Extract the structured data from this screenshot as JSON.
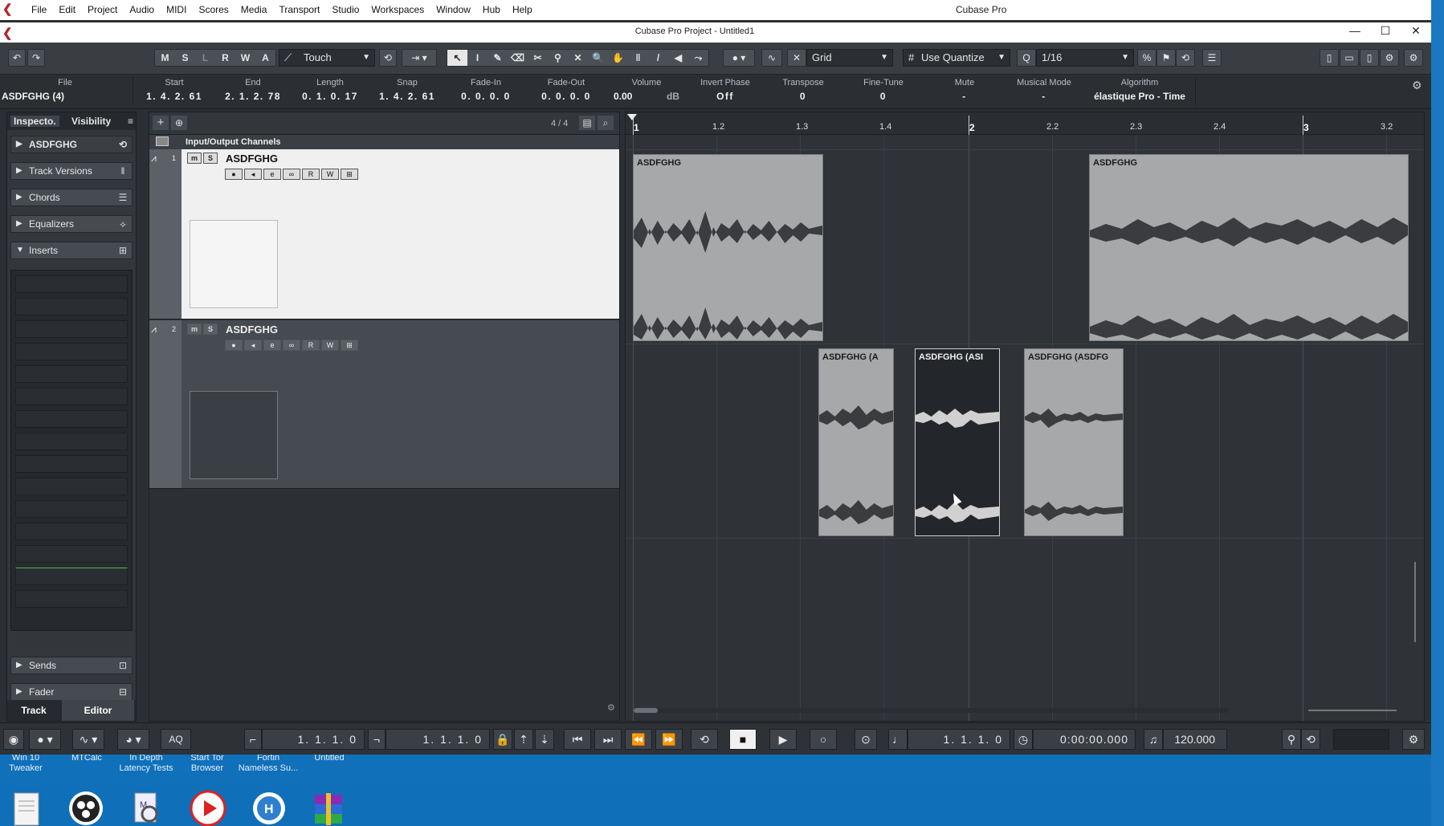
{
  "menubar": {
    "items": [
      "File",
      "Edit",
      "Project",
      "Audio",
      "MIDI",
      "Scores",
      "Media",
      "Transport",
      "Studio",
      "Workspaces",
      "Window",
      "Hub",
      "Help"
    ],
    "app_title": "Cubase Pro"
  },
  "window": {
    "title": "Cubase Pro Project - Untitled1"
  },
  "toolbar": {
    "mode_buttons": [
      "M",
      "S",
      "L",
      "R",
      "W",
      "A"
    ],
    "automation_mode": "Touch",
    "snap_type": "Grid",
    "quantize_mode": "Use Quantize",
    "quantize_value": "1/16"
  },
  "infoline": {
    "file_label": "File",
    "file_value": "ASDFGHG (4)",
    "start_label": "Start",
    "start_value": "1. 4. 2. 61",
    "end_label": "End",
    "end_value": "2. 1. 2. 78",
    "length_label": "Length",
    "length_value": "0. 1. 0. 17",
    "snap_label": "Snap",
    "snap_value": "1. 4. 2. 61",
    "fadein_label": "Fade-In",
    "fadein_value": "0. 0. 0. 0",
    "fadeout_label": "Fade-Out",
    "fadeout_value": "0. 0. 0. 0",
    "volume_label": "Volume",
    "volume_value": "0.00",
    "volume_unit": "dB",
    "invert_label": "Invert Phase",
    "invert_value": "Off",
    "transpose_label": "Transpose",
    "transpose_value": "0",
    "finetune_label": "Fine-Tune",
    "finetune_value": "0",
    "mute_label": "Mute",
    "mute_value": "-",
    "musical_label": "Musical Mode",
    "musical_value": "-",
    "algo_label": "Algorithm",
    "algo_value": "élastique Pro - Time"
  },
  "inspector": {
    "tab_inspector": "Inspecto.",
    "tab_visibility": "Visibility",
    "track_name": "ASDFGHG",
    "sections": [
      "Track Versions",
      "Chords",
      "Equalizers",
      "Inserts"
    ],
    "sends": "Sends",
    "fader": "Fader",
    "bottom_tab_track": "Track",
    "bottom_tab_editor": "Editor"
  },
  "tracklist": {
    "count": "4 / 4",
    "folder": "Input/Output Channels",
    "tracks": [
      {
        "num": "1",
        "name": "ASDFGHG"
      },
      {
        "num": "2",
        "name": "ASDFGHG"
      }
    ]
  },
  "ruler": {
    "labels": [
      "1",
      "1.2",
      "1.3",
      "1.4",
      "2",
      "2.2",
      "2.3",
      "2.4",
      "3",
      "3.2"
    ]
  },
  "clips": [
    {
      "name": "ASDFGHG"
    },
    {
      "name": "ASDFGHG"
    },
    {
      "name": "ASDFGHG (A"
    },
    {
      "name": "ASDFGHG (ASI"
    },
    {
      "name": "ASDFGHG (ASDFG"
    }
  ],
  "transport": {
    "left_locator": "1. 1. 1.   0",
    "right_locator": "1. 1. 1.   0",
    "position": "1. 1. 1.   0",
    "time": "0:00:00.000",
    "tempo": "120.000",
    "aq": "AQ"
  },
  "desktop": {
    "labels": [
      "Win 10\nTweaker",
      "MTCalc",
      "In Depth\nLatency Tests",
      "Start Tor\nBrowser",
      "Fortin\nNameless Su...",
      "Untitled"
    ]
  }
}
